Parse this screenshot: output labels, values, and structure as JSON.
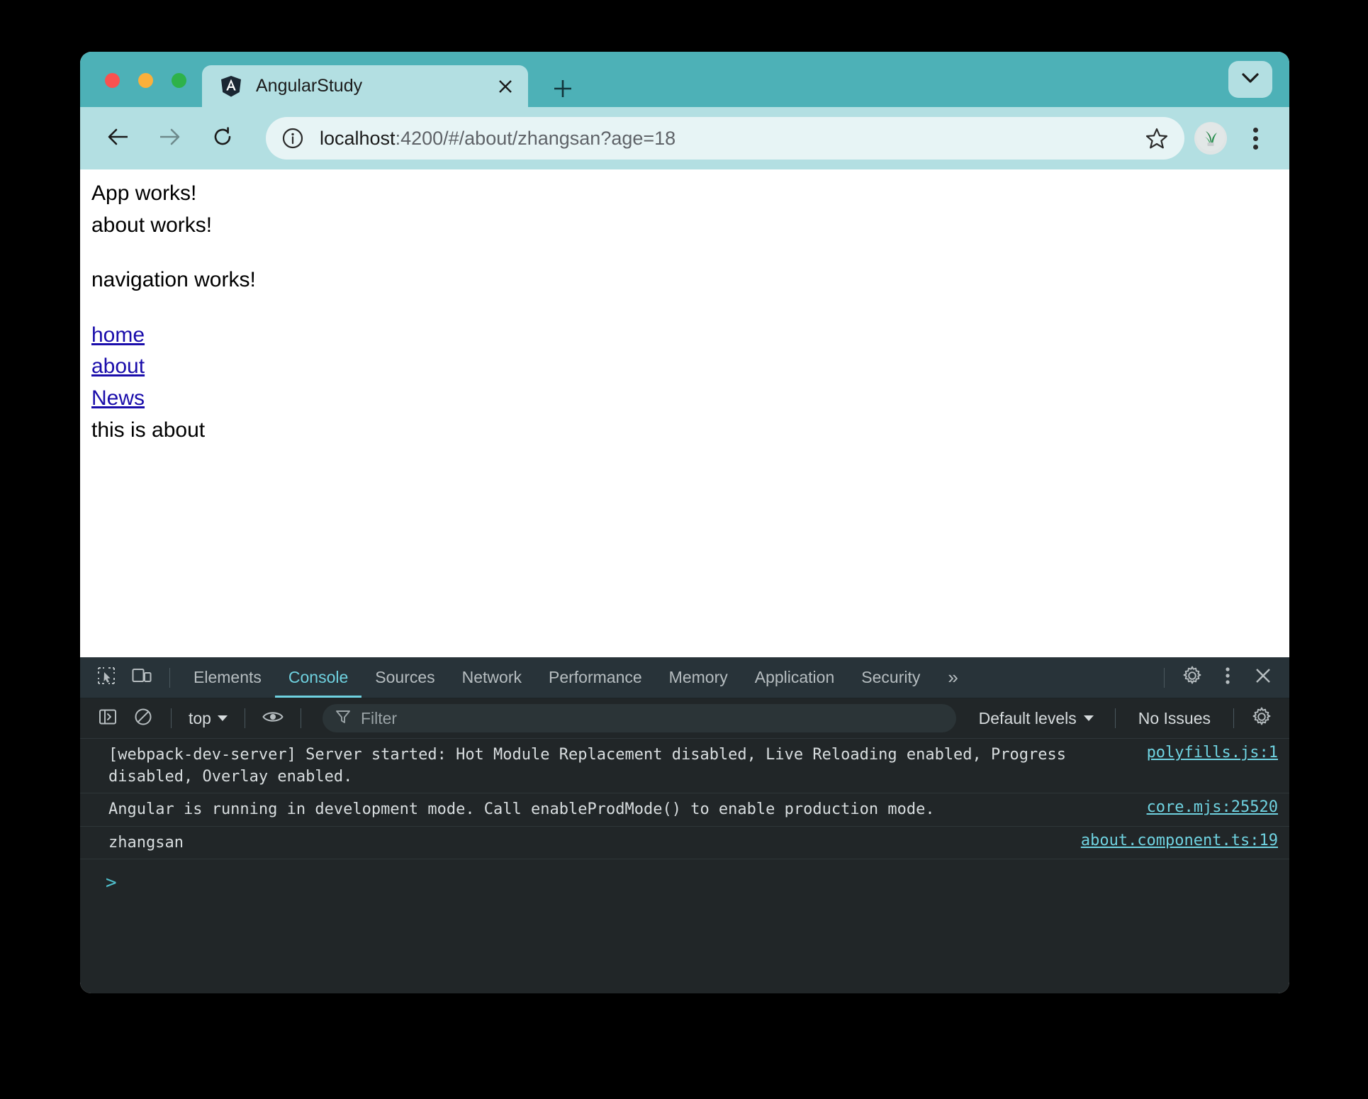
{
  "window": {
    "traffic_lights": [
      "close",
      "minimize",
      "zoom"
    ]
  },
  "tabstrip": {
    "tab": {
      "title": "AngularStudy",
      "favicon": "angular-logo-icon",
      "close_icon": "close-icon"
    },
    "new_tab_icon": "plus-icon",
    "tab_search_icon": "chevron-down-icon"
  },
  "toolbar": {
    "back_icon": "arrow-left-icon",
    "forward_icon": "arrow-right-icon",
    "reload_icon": "reload-icon",
    "security_icon": "info-circle-icon",
    "url_host": "localhost",
    "url_rest": ":4200/#/about/zhangsan?age=18",
    "url_full": "localhost:4200/#/about/zhangsan?age=18",
    "bookmark_icon": "star-outline-icon",
    "profile_icon": "avatar-plant-icon",
    "menu_icon": "kebab-menu-icon"
  },
  "page": {
    "lines": [
      "App works!",
      "about works!"
    ],
    "navigation_heading": "navigation works!",
    "links": [
      "home",
      "about",
      "News"
    ],
    "footer_text": "this is about"
  },
  "devtools": {
    "inspect_icon": "inspect-element-icon",
    "device_icon": "device-toolbar-icon",
    "tabs": [
      {
        "label": "Elements",
        "active": false
      },
      {
        "label": "Console",
        "active": true
      },
      {
        "label": "Sources",
        "active": false
      },
      {
        "label": "Network",
        "active": false
      },
      {
        "label": "Performance",
        "active": false
      },
      {
        "label": "Memory",
        "active": false
      },
      {
        "label": "Application",
        "active": false
      },
      {
        "label": "Security",
        "active": false
      }
    ],
    "overflow_label": "»",
    "settings_icon": "gear-icon",
    "more_icon": "kebab-menu-icon",
    "close_icon": "close-icon",
    "console_toolbar": {
      "sidebar_icon": "console-sidebar-icon",
      "clear_icon": "clear-console-icon",
      "context": "top",
      "eye_icon": "live-expression-icon",
      "filter_icon": "filter-icon",
      "filter_placeholder": "Filter",
      "levels": "Default levels",
      "issues": "No Issues",
      "settings_icon": "gear-icon"
    },
    "messages": [
      {
        "text": "[webpack-dev-server] Server started: Hot Module Replacement disabled, Live Reloading enabled, Progress disabled, Overlay enabled.",
        "source": "polyfills.js:1"
      },
      {
        "text": "Angular is running in development mode. Call enableProdMode() to enable production mode.",
        "source": "core.mjs:25520"
      },
      {
        "text": "zhangsan",
        "source": "about.component.ts:19"
      }
    ],
    "prompt": ">"
  },
  "colors": {
    "tabstrip_bg": "#4db1b7",
    "toolbar_bg": "#b3dfe2",
    "omnibox_bg": "#e7f4f5",
    "devtools_tabbar_bg": "#283339",
    "devtools_bg": "#212628",
    "accent_cyan": "#6fd2e0",
    "link_blue": "#1a0dab"
  }
}
